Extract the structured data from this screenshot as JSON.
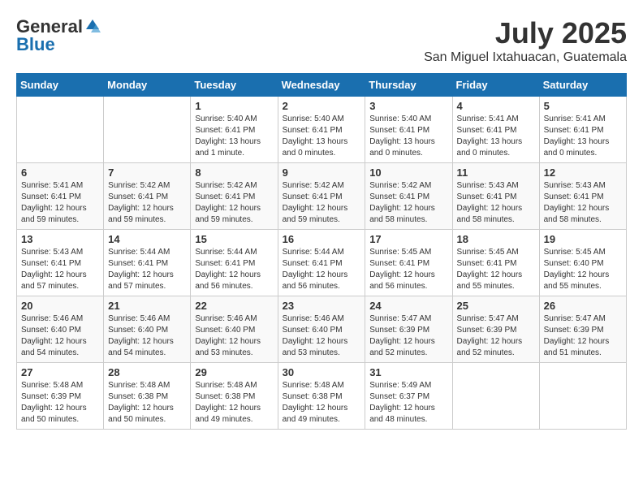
{
  "header": {
    "logo_general": "General",
    "logo_blue": "Blue",
    "month_title": "July 2025",
    "location": "San Miguel Ixtahuacan, Guatemala"
  },
  "days_of_week": [
    "Sunday",
    "Monday",
    "Tuesday",
    "Wednesday",
    "Thursday",
    "Friday",
    "Saturday"
  ],
  "weeks": [
    [
      {
        "day": "",
        "info": ""
      },
      {
        "day": "",
        "info": ""
      },
      {
        "day": "1",
        "info": "Sunrise: 5:40 AM\nSunset: 6:41 PM\nDaylight: 13 hours and 1 minute."
      },
      {
        "day": "2",
        "info": "Sunrise: 5:40 AM\nSunset: 6:41 PM\nDaylight: 13 hours and 0 minutes."
      },
      {
        "day": "3",
        "info": "Sunrise: 5:40 AM\nSunset: 6:41 PM\nDaylight: 13 hours and 0 minutes."
      },
      {
        "day": "4",
        "info": "Sunrise: 5:41 AM\nSunset: 6:41 PM\nDaylight: 13 hours and 0 minutes."
      },
      {
        "day": "5",
        "info": "Sunrise: 5:41 AM\nSunset: 6:41 PM\nDaylight: 13 hours and 0 minutes."
      }
    ],
    [
      {
        "day": "6",
        "info": "Sunrise: 5:41 AM\nSunset: 6:41 PM\nDaylight: 12 hours and 59 minutes."
      },
      {
        "day": "7",
        "info": "Sunrise: 5:42 AM\nSunset: 6:41 PM\nDaylight: 12 hours and 59 minutes."
      },
      {
        "day": "8",
        "info": "Sunrise: 5:42 AM\nSunset: 6:41 PM\nDaylight: 12 hours and 59 minutes."
      },
      {
        "day": "9",
        "info": "Sunrise: 5:42 AM\nSunset: 6:41 PM\nDaylight: 12 hours and 59 minutes."
      },
      {
        "day": "10",
        "info": "Sunrise: 5:42 AM\nSunset: 6:41 PM\nDaylight: 12 hours and 58 minutes."
      },
      {
        "day": "11",
        "info": "Sunrise: 5:43 AM\nSunset: 6:41 PM\nDaylight: 12 hours and 58 minutes."
      },
      {
        "day": "12",
        "info": "Sunrise: 5:43 AM\nSunset: 6:41 PM\nDaylight: 12 hours and 58 minutes."
      }
    ],
    [
      {
        "day": "13",
        "info": "Sunrise: 5:43 AM\nSunset: 6:41 PM\nDaylight: 12 hours and 57 minutes."
      },
      {
        "day": "14",
        "info": "Sunrise: 5:44 AM\nSunset: 6:41 PM\nDaylight: 12 hours and 57 minutes."
      },
      {
        "day": "15",
        "info": "Sunrise: 5:44 AM\nSunset: 6:41 PM\nDaylight: 12 hours and 56 minutes."
      },
      {
        "day": "16",
        "info": "Sunrise: 5:44 AM\nSunset: 6:41 PM\nDaylight: 12 hours and 56 minutes."
      },
      {
        "day": "17",
        "info": "Sunrise: 5:45 AM\nSunset: 6:41 PM\nDaylight: 12 hours and 56 minutes."
      },
      {
        "day": "18",
        "info": "Sunrise: 5:45 AM\nSunset: 6:41 PM\nDaylight: 12 hours and 55 minutes."
      },
      {
        "day": "19",
        "info": "Sunrise: 5:45 AM\nSunset: 6:40 PM\nDaylight: 12 hours and 55 minutes."
      }
    ],
    [
      {
        "day": "20",
        "info": "Sunrise: 5:46 AM\nSunset: 6:40 PM\nDaylight: 12 hours and 54 minutes."
      },
      {
        "day": "21",
        "info": "Sunrise: 5:46 AM\nSunset: 6:40 PM\nDaylight: 12 hours and 54 minutes."
      },
      {
        "day": "22",
        "info": "Sunrise: 5:46 AM\nSunset: 6:40 PM\nDaylight: 12 hours and 53 minutes."
      },
      {
        "day": "23",
        "info": "Sunrise: 5:46 AM\nSunset: 6:40 PM\nDaylight: 12 hours and 53 minutes."
      },
      {
        "day": "24",
        "info": "Sunrise: 5:47 AM\nSunset: 6:39 PM\nDaylight: 12 hours and 52 minutes."
      },
      {
        "day": "25",
        "info": "Sunrise: 5:47 AM\nSunset: 6:39 PM\nDaylight: 12 hours and 52 minutes."
      },
      {
        "day": "26",
        "info": "Sunrise: 5:47 AM\nSunset: 6:39 PM\nDaylight: 12 hours and 51 minutes."
      }
    ],
    [
      {
        "day": "27",
        "info": "Sunrise: 5:48 AM\nSunset: 6:39 PM\nDaylight: 12 hours and 50 minutes."
      },
      {
        "day": "28",
        "info": "Sunrise: 5:48 AM\nSunset: 6:38 PM\nDaylight: 12 hours and 50 minutes."
      },
      {
        "day": "29",
        "info": "Sunrise: 5:48 AM\nSunset: 6:38 PM\nDaylight: 12 hours and 49 minutes."
      },
      {
        "day": "30",
        "info": "Sunrise: 5:48 AM\nSunset: 6:38 PM\nDaylight: 12 hours and 49 minutes."
      },
      {
        "day": "31",
        "info": "Sunrise: 5:49 AM\nSunset: 6:37 PM\nDaylight: 12 hours and 48 minutes."
      },
      {
        "day": "",
        "info": ""
      },
      {
        "day": "",
        "info": ""
      }
    ]
  ]
}
